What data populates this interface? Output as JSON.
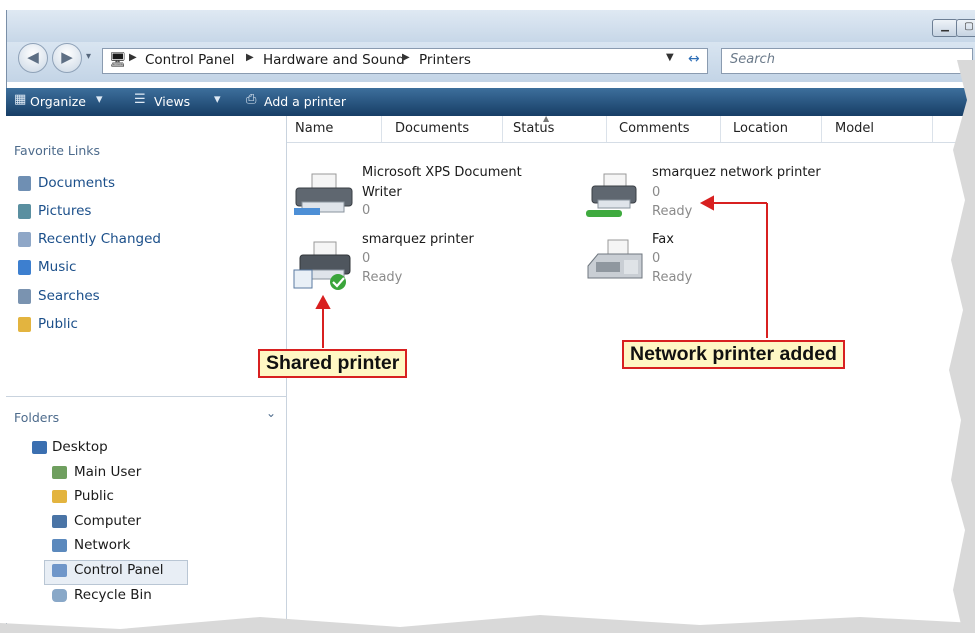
{
  "window": {
    "minimize_icon": "minimize-icon",
    "maximize_icon": "maximize-icon"
  },
  "address": {
    "crumbs": [
      "Control Panel",
      "Hardware and Sound",
      "Printers"
    ],
    "search_placeholder": "Search"
  },
  "toolbar": {
    "organize": "Organize",
    "views": "Views",
    "add_printer": "Add a printer"
  },
  "sidebar": {
    "favorites_header": "Favorite Links",
    "favorites": [
      "Documents",
      "Pictures",
      "Recently Changed",
      "Music",
      "Searches",
      "Public"
    ],
    "folders_header": "Folders",
    "tree": [
      "Desktop",
      "Main User",
      "Public",
      "Computer",
      "Network",
      "Control Panel",
      "Recycle Bin"
    ]
  },
  "columns": [
    "Name",
    "Documents",
    "Status",
    "Comments",
    "Location",
    "Model"
  ],
  "printers": [
    {
      "name_line1": "Microsoft XPS Document",
      "name_line2": "Writer",
      "docs": "0",
      "status": ""
    },
    {
      "name_line1": "smarquez network printer",
      "name_line2": "",
      "docs": "0",
      "status": "Ready"
    },
    {
      "name_line1": "smarquez printer",
      "name_line2": "",
      "docs": "0",
      "status": "Ready"
    },
    {
      "name_line1": "Fax",
      "name_line2": "",
      "docs": "0",
      "status": "Ready"
    }
  ],
  "callouts": {
    "shared": "Shared printer",
    "network": "Network printer added"
  },
  "colors": {
    "callout_border": "#d82020",
    "callout_fill": "#fff7c4",
    "toolbar": "#1f4a75"
  }
}
